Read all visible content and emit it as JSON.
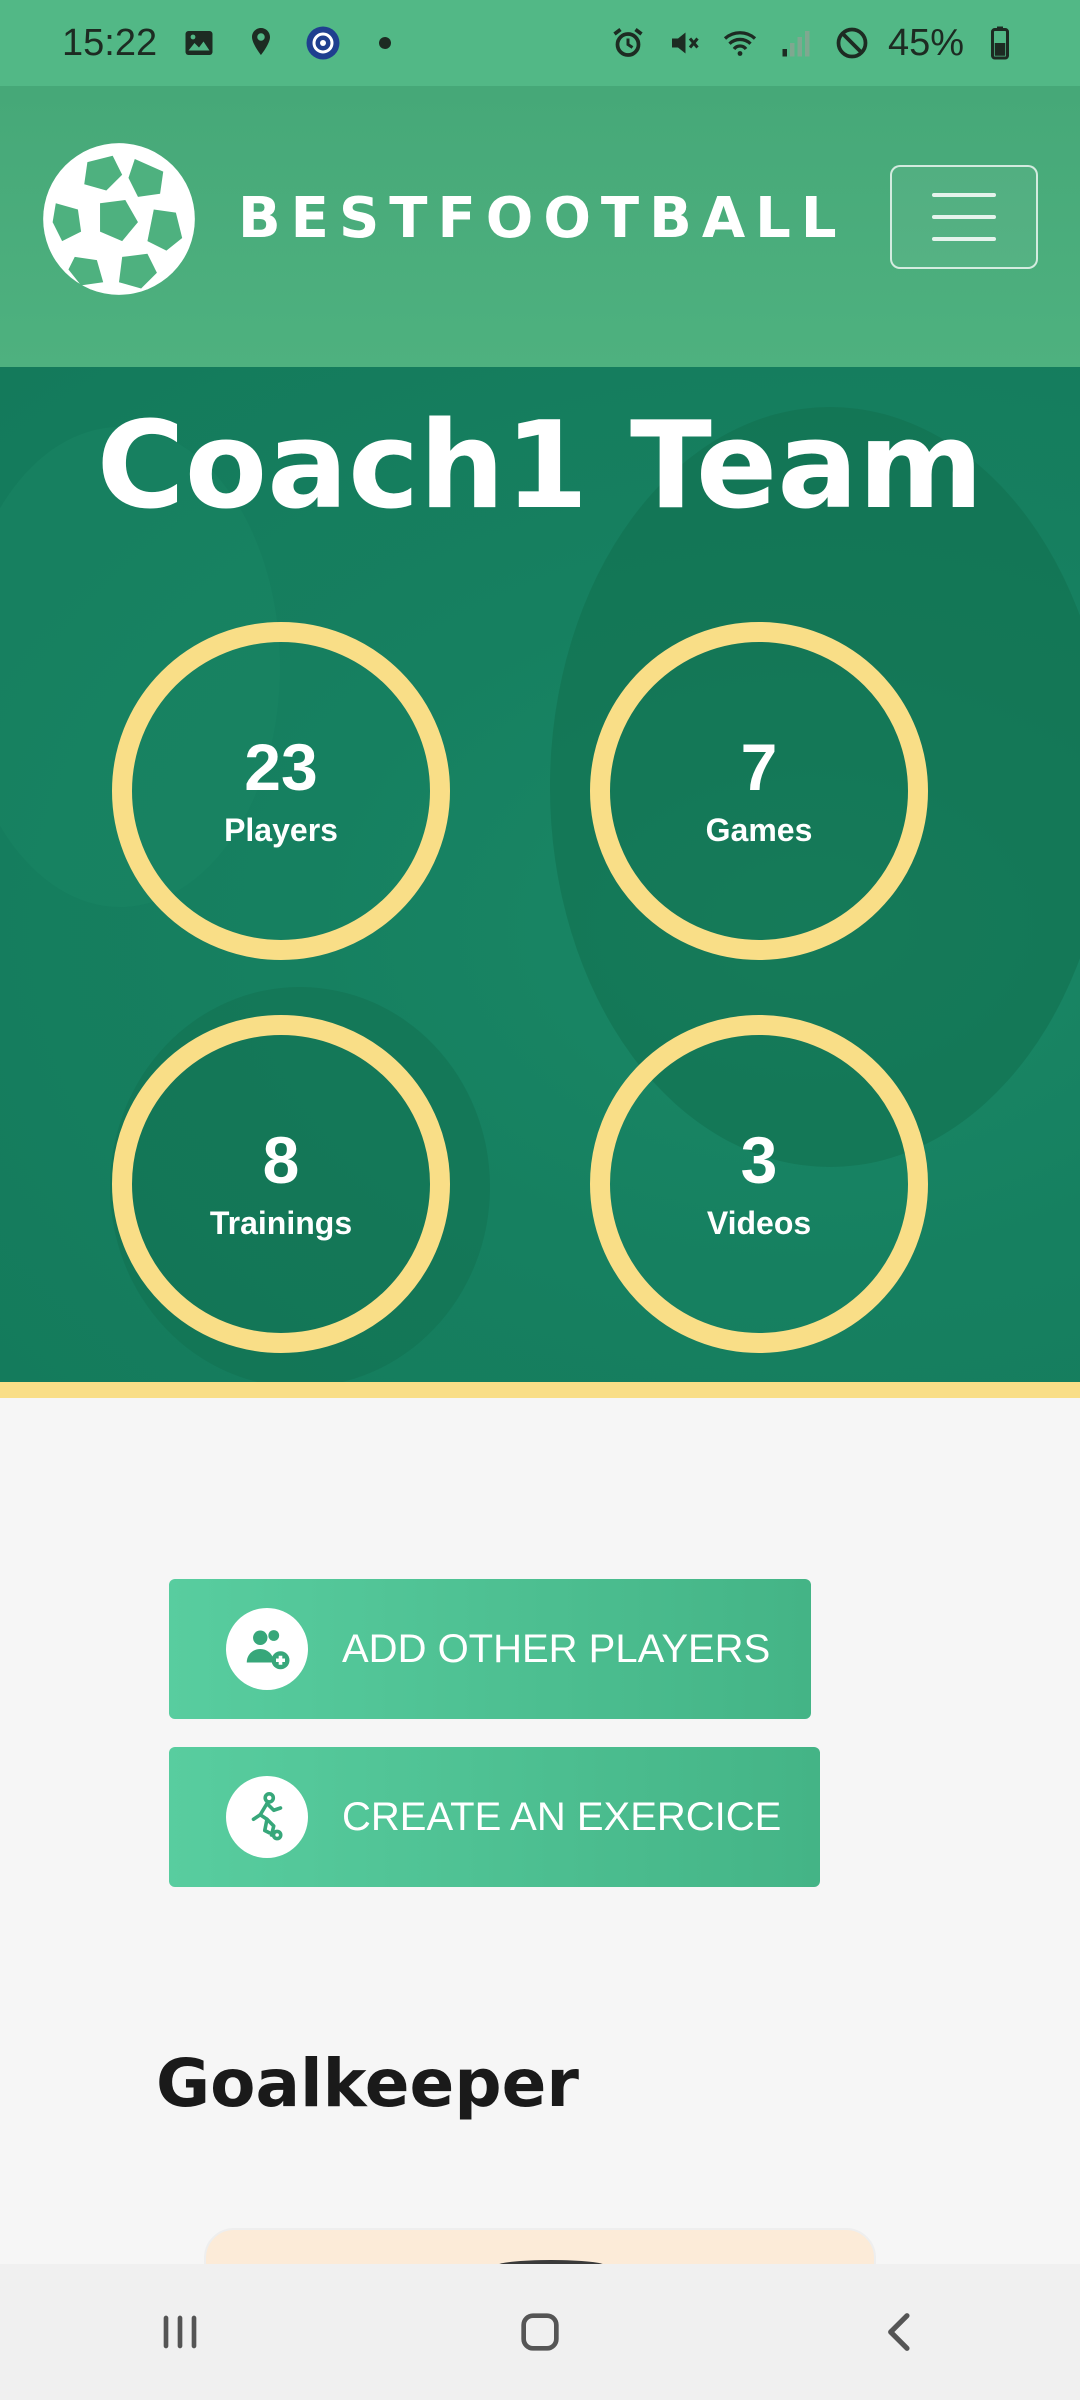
{
  "status_bar": {
    "time": "15:22",
    "battery": "45%",
    "left_icons": [
      "gallery-icon",
      "location-icon",
      "vpn-app-icon",
      "dot-icon"
    ],
    "right_icons": [
      "alarm-icon",
      "mute-icon",
      "wifi-icon",
      "signal-icon",
      "dnd-icon",
      "battery-icon"
    ]
  },
  "header": {
    "brand": "BESTFOOTBALL",
    "logo_icon": "football-logo-icon",
    "menu_icon": "hamburger-menu-icon"
  },
  "hero": {
    "title": "Coach1 Team",
    "stats": [
      {
        "value": "23",
        "label": "Players"
      },
      {
        "value": "7",
        "label": "Games"
      },
      {
        "value": "8",
        "label": "Trainings"
      },
      {
        "value": "3",
        "label": "Videos"
      }
    ]
  },
  "actions": {
    "add_players": "ADD OTHER PLAYERS",
    "create_exercise": "CREATE AN EXERCICE"
  },
  "section": {
    "title": "Goalkeeper"
  },
  "colors": {
    "status_bar": "#52b886",
    "header": "#4eb17f",
    "hero": "#168060",
    "ring": "#f9de87",
    "button": "#4cc092"
  },
  "navbar": {
    "icons": [
      "recent-apps-icon",
      "home-icon",
      "back-icon"
    ]
  }
}
